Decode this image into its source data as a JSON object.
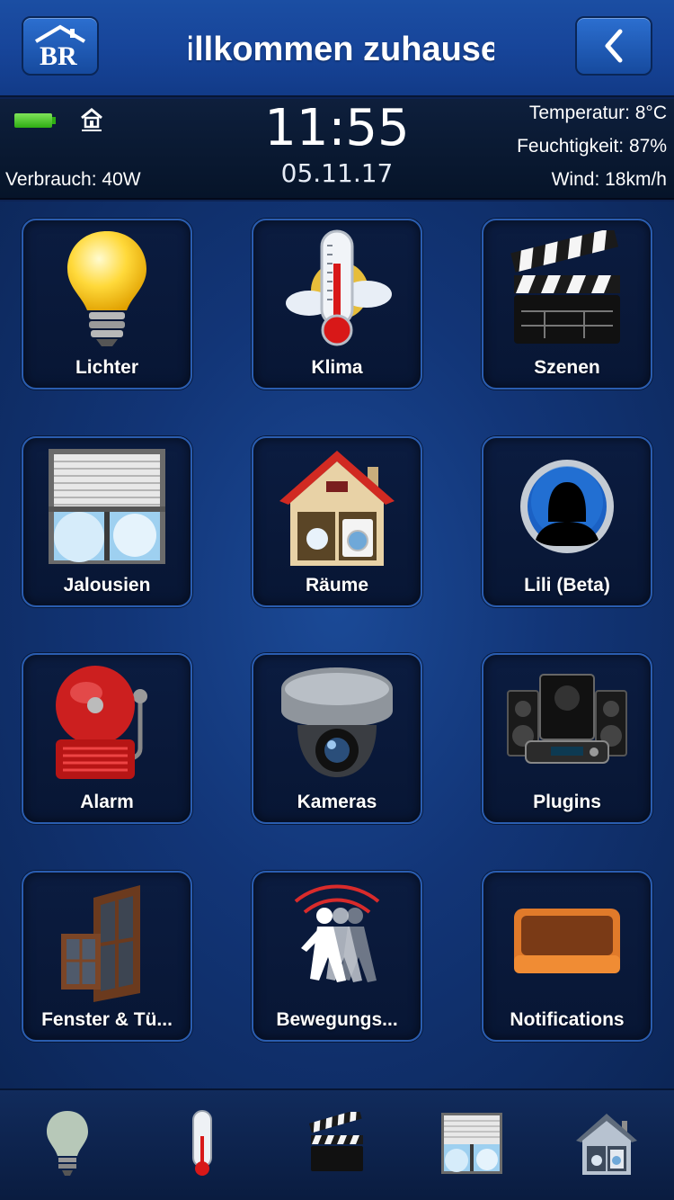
{
  "header": {
    "title": "Willkommen zuhause   Willkommen zuhause",
    "logo_label": "BR",
    "back_icon": "chevron-left-icon"
  },
  "status": {
    "consumption": "Verbrauch: 40W",
    "time": "11:55",
    "date": "05.11.17",
    "temperature": "Temperatur: 8°C",
    "humidity": "Feuchtigkeit: 87%",
    "wind": "Wind: 18km/h"
  },
  "tiles": [
    {
      "label": "Lichter",
      "icon": "lightbulb-icon"
    },
    {
      "label": "Klima",
      "icon": "thermometer-icon"
    },
    {
      "label": "Szenen",
      "icon": "clapperboard-icon"
    },
    {
      "label": "Jalousien",
      "icon": "blinds-icon"
    },
    {
      "label": "Räume",
      "icon": "house-icon"
    },
    {
      "label": "Lili (Beta)",
      "icon": "user-silhouette-icon"
    },
    {
      "label": "Alarm",
      "icon": "alarm-bell-icon"
    },
    {
      "label": "Kameras",
      "icon": "security-camera-icon"
    },
    {
      "label": "Plugins",
      "icon": "speakers-icon"
    },
    {
      "label": "Fenster & Tü...",
      "icon": "window-door-icon"
    },
    {
      "label": "Bewegungs...",
      "icon": "motion-icon"
    },
    {
      "label": "Notifications",
      "icon": "tray-icon"
    }
  ],
  "tabbar": [
    "lightbulb-icon",
    "thermometer-icon",
    "clapperboard-icon",
    "blinds-icon",
    "house-icon"
  ],
  "colors": {
    "header": "#17459a",
    "background": "#123577",
    "tile_border": "#2a5db0"
  }
}
